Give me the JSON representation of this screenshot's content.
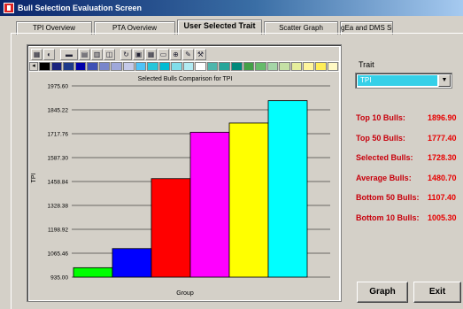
{
  "window": {
    "title": "Bull Selection Evaluation Screen"
  },
  "tabs": [
    {
      "label": "TPI Overview",
      "active": false
    },
    {
      "label": "PTA Overview",
      "active": false
    },
    {
      "label": "User Selected Trait",
      "active": true
    },
    {
      "label": "Scatter Graph",
      "active": false
    },
    {
      "label": "gEa and DMS Summary",
      "active": false
    }
  ],
  "toolbar": {
    "icons": [
      "chart-type-icon",
      "color-icon",
      "gallery-icon",
      "print-icon",
      "copy-icon",
      "3d-icon",
      "rotate-icon",
      "legend-icon",
      "grid-icon",
      "data-editor-icon",
      "zoom-icon",
      "properties-icon",
      "tools-icon"
    ]
  },
  "palette_colors": [
    "#000000",
    "#1a237e",
    "#1e3a8a",
    "#0000aa",
    "#3f51b5",
    "#7986cb",
    "#9fa8da",
    "#c5cae9",
    "#4fc3f7",
    "#26c6da",
    "#00bcd4",
    "#80deea",
    "#b2ebf2",
    "#ffffff",
    "#4db6ac",
    "#26a69a",
    "#00897b",
    "#43a047",
    "#66bb6a",
    "#a5d6a7",
    "#c5e1a5",
    "#e6ee9c",
    "#fff59d",
    "#ffee58",
    "#fff9c4"
  ],
  "chart_data": {
    "type": "bar",
    "title": "Selected Bulls Comparison for TPI",
    "xlabel": "Group",
    "ylabel": "TPI",
    "ylim": [
      955.0,
      1975.6
    ],
    "yticks": [
      "1975.60",
      "1845.22",
      "1717.76",
      "1587.30",
      "1458.84",
      "1328.38",
      "1198.92",
      "1065.46",
      "935.00"
    ],
    "grid": true,
    "values": [
      1005.3,
      1107.4,
      1480.7,
      1728.3,
      1777.4,
      1896.9
    ],
    "colors": [
      "#00ff00",
      "#0000ff",
      "#ff0000",
      "#ff00ff",
      "#ffff00",
      "#00ffff"
    ]
  },
  "trait": {
    "label": "Trait",
    "selected": "TPI"
  },
  "stats": [
    {
      "label": "Top 10 Bulls:",
      "value": "1896.90"
    },
    {
      "label": "Top 50 Bulls:",
      "value": "1777.40"
    },
    {
      "label": "Selected Bulls:",
      "value": "1728.30"
    },
    {
      "label": "Average Bulls:",
      "value": "1480.70"
    },
    {
      "label": "Bottom 50 Bulls:",
      "value": "1107.40"
    },
    {
      "label": "Bottom 10 Bulls:",
      "value": "1005.30"
    }
  ],
  "buttons": {
    "graph": "Graph",
    "exit": "Exit"
  }
}
